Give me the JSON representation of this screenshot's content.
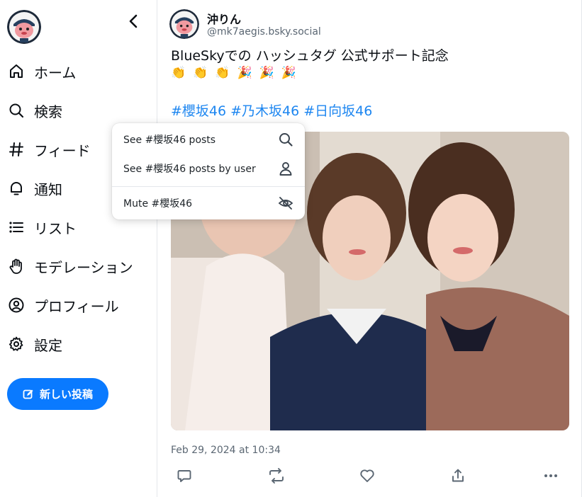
{
  "sidebar": {
    "items": [
      {
        "label": "ホーム",
        "icon": "home-icon"
      },
      {
        "label": "検索",
        "icon": "search-icon"
      },
      {
        "label": "フィード",
        "icon": "hash-icon"
      },
      {
        "label": "通知",
        "icon": "bell-icon"
      },
      {
        "label": "リスト",
        "icon": "list-icon"
      },
      {
        "label": "モデレーション",
        "icon": "hand-icon"
      },
      {
        "label": "プロフィール",
        "icon": "user-circle-icon"
      },
      {
        "label": "設定",
        "icon": "gear-icon"
      }
    ],
    "compose_label": "新しい投稿"
  },
  "post": {
    "display_name": "沖りん",
    "handle": "@mk7aegis.bsky.social",
    "text": "BlueSkyでの ハッシュタグ 公式サポート記念",
    "emojis": [
      "👏",
      "👏",
      "👏",
      "🎉",
      "🎉",
      "🎉"
    ],
    "hashtags": [
      "#櫻坂46",
      "#乃木坂46",
      "#日向坂46"
    ],
    "timestamp": "Feb 29, 2024 at 10:34"
  },
  "menu": {
    "items": [
      {
        "label": "See #櫻坂46 posts",
        "icon": "search-icon"
      },
      {
        "label": "See #櫻坂46 posts by user",
        "icon": "person-icon"
      },
      {
        "label": "Mute #櫻坂46",
        "icon": "eye-slash-icon"
      }
    ]
  },
  "colors": {
    "accent": "#0a7aff",
    "hashtag": "#1d86f0",
    "muted_text": "#5b6773"
  }
}
